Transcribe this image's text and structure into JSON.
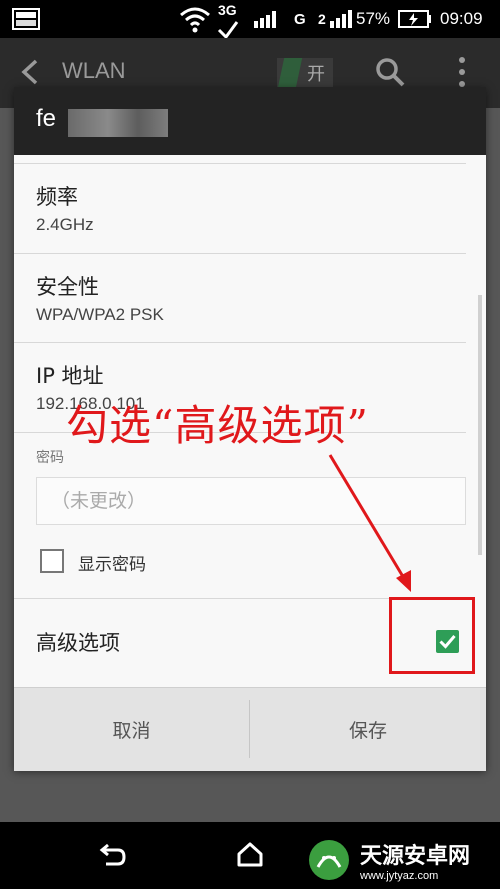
{
  "status_bar": {
    "network_3g": "3G",
    "network_g": "G",
    "network_2": "2",
    "battery_percent": "57%",
    "time": "09:09",
    "icons": [
      "image-icon",
      "wifi-icon",
      "signal-icon",
      "battery-charging-icon"
    ]
  },
  "action_bar": {
    "title": "WLAN",
    "toggle_label": "开"
  },
  "dialog": {
    "title": "fe",
    "fields": [
      {
        "label": "频率",
        "value": "2.4GHz"
      },
      {
        "label": "安全性",
        "value": "WPA/WPA2 PSK"
      },
      {
        "label": "IP 地址",
        "value": "192.168.0.101"
      }
    ],
    "password_label": "密码",
    "password_placeholder": "（未更改）",
    "show_password_label": "显示密码",
    "show_password_checked": false,
    "advanced_label": "高级选项",
    "advanced_checked": true,
    "cancel_label": "取消",
    "save_label": "保存"
  },
  "annotation": {
    "text": "勾选“高级选项”",
    "color": "#e0181b"
  },
  "watermark": {
    "title": "天源安卓网",
    "url": "www.jytyaz.com"
  },
  "colors": {
    "accent_green": "#2e9e57",
    "annotation_red": "#e0181b",
    "dialog_header": "#232323"
  }
}
